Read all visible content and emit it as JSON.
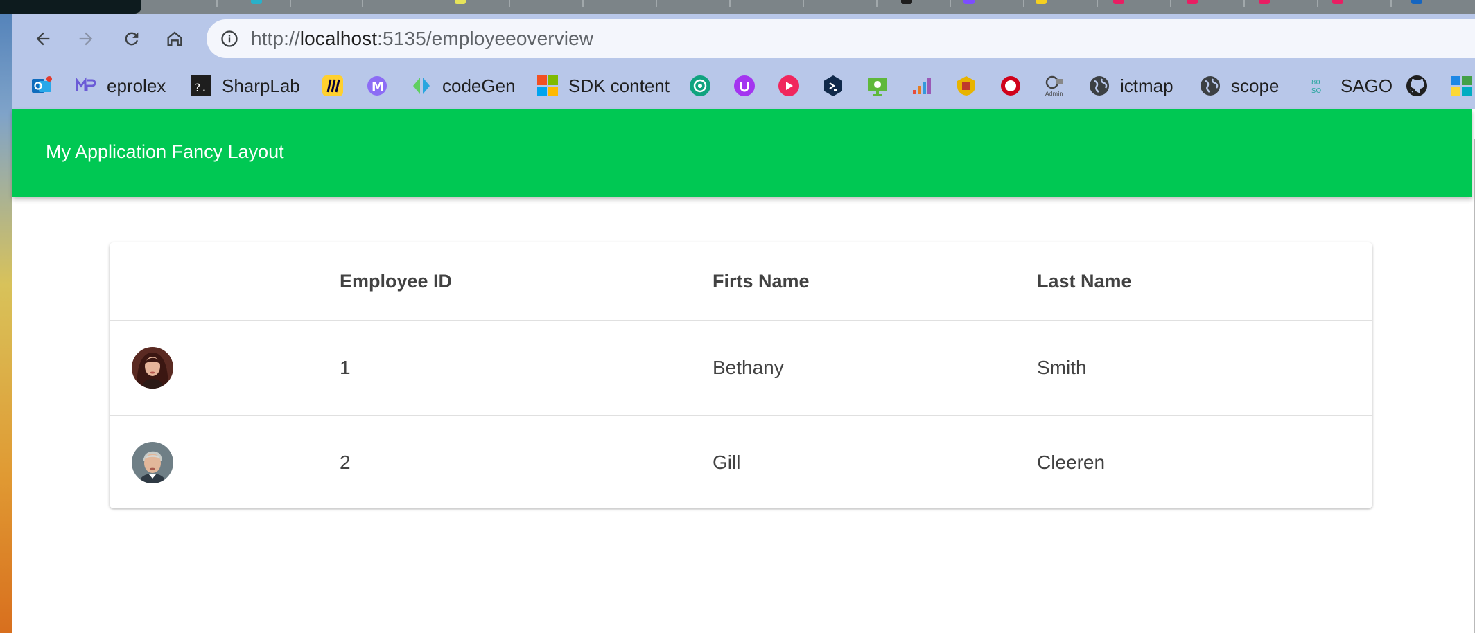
{
  "browser": {
    "url_scheme": "http://",
    "url_host": "localhost",
    "url_rest": ":5135/employeeoverview",
    "nav": {
      "back_icon": "arrow-left-icon",
      "forward_icon": "arrow-right-icon",
      "reload_icon": "reload-icon",
      "home_icon": "home-icon"
    }
  },
  "bookmarks": [
    {
      "label": "",
      "icon": "outlook-icon",
      "color": "#0f6cbd"
    },
    {
      "label": "eprolex",
      "icon": "eprolex-icon",
      "color": "#6b5bd6"
    },
    {
      "label": "SharpLab",
      "icon": "sharplab-icon",
      "color": "#1e1e1e"
    },
    {
      "label": "",
      "icon": "miro-icon",
      "color": "#ffd02f"
    },
    {
      "label": "",
      "icon": "mastodon-icon",
      "color": "#7a5af5"
    },
    {
      "label": "codeGen",
      "icon": "codegen-icon",
      "color": "#2aa6df"
    },
    {
      "label": "SDK content",
      "icon": "microsoft-icon",
      "color": "#f25022"
    },
    {
      "label": "",
      "icon": "chatgpt-icon",
      "color": "#10a37f"
    },
    {
      "label": "",
      "icon": "udemy-icon",
      "color": "#a435f0"
    },
    {
      "label": "",
      "icon": "play-icon",
      "color": "#f0265d"
    },
    {
      "label": "",
      "icon": "terminal-icon",
      "color": "#10294a"
    },
    {
      "label": "",
      "icon": "cloud-monitor-icon",
      "color": "#5fb83b"
    },
    {
      "label": "",
      "icon": "bars-icon",
      "color": "#e67e22"
    },
    {
      "label": "",
      "icon": "crest-icon",
      "color": "#e8b400"
    },
    {
      "label": "",
      "icon": "badge-icon",
      "color": "#d0021b"
    },
    {
      "label": "",
      "icon": "admin-icon",
      "color": "#555555"
    },
    {
      "label": "ictmap",
      "icon": "globe-icon",
      "color": "#3c4043"
    },
    {
      "label": "scope",
      "icon": "globe-icon",
      "color": "#3c4043"
    },
    {
      "label": "SAGO",
      "icon": "sago-icon",
      "color": "#2aa6a0"
    },
    {
      "label": "",
      "icon": "github-icon",
      "color": "#1f1f1f"
    },
    {
      "label": "",
      "icon": "tile-icon",
      "color": "#1e88e5"
    }
  ],
  "app": {
    "title": "My Application Fancy Layout",
    "header_color": "#00c853"
  },
  "table": {
    "columns": [
      "",
      "Employee ID",
      "Firts Name",
      "Last Name"
    ],
    "rows": [
      {
        "avatar": "avatar-woman",
        "id": "1",
        "first": "Bethany",
        "last": "Smith"
      },
      {
        "avatar": "avatar-man",
        "id": "2",
        "first": "Gill",
        "last": "Cleeren"
      }
    ]
  }
}
